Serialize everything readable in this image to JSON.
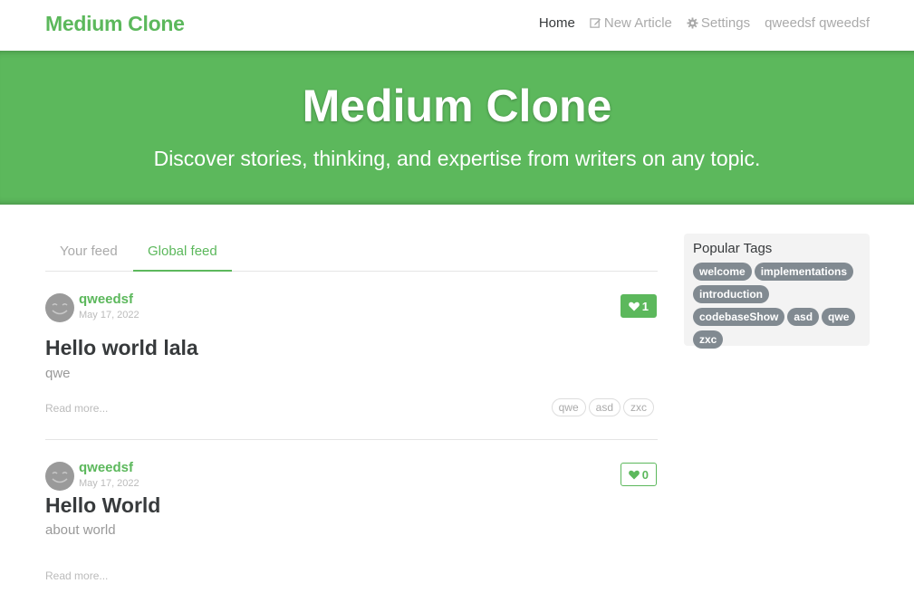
{
  "navbar": {
    "brand": "Medium Clone",
    "items": [
      {
        "label": "Home",
        "icon": "",
        "active": true
      },
      {
        "label": "New Article",
        "icon": "edit-icon"
      },
      {
        "label": "Settings",
        "icon": "gear-icon"
      },
      {
        "label": "qweedsf qweedsf",
        "icon": ""
      }
    ]
  },
  "banner": {
    "title": "Medium Clone",
    "subtitle": "Discover stories, thinking, and expertise from writers on any topic."
  },
  "feed": {
    "tabs": [
      {
        "label": "Your feed",
        "active": false
      },
      {
        "label": "Global feed",
        "active": true
      }
    ]
  },
  "articles": [
    {
      "author": "qweedsf",
      "date": "May 17, 2022",
      "favorites": "1",
      "favorited": true,
      "title": "Hello world lala",
      "description": "qwe",
      "read_more": "Read more...",
      "tags": [
        "qwe",
        "asd",
        "zxc"
      ]
    },
    {
      "author": "qweedsf",
      "date": "May 17, 2022",
      "favorites": "0",
      "favorited": false,
      "title": "Hello World",
      "description": "about world",
      "read_more": "Read more...",
      "tags": []
    }
  ],
  "sidebar": {
    "title": "Popular Tags",
    "tags": [
      "welcome",
      "implementations",
      "introduction",
      "codebaseShow",
      "asd",
      "qwe",
      "zxc"
    ]
  },
  "colors": {
    "accent": "#5cb85c",
    "tag_pill": "#818a91"
  }
}
